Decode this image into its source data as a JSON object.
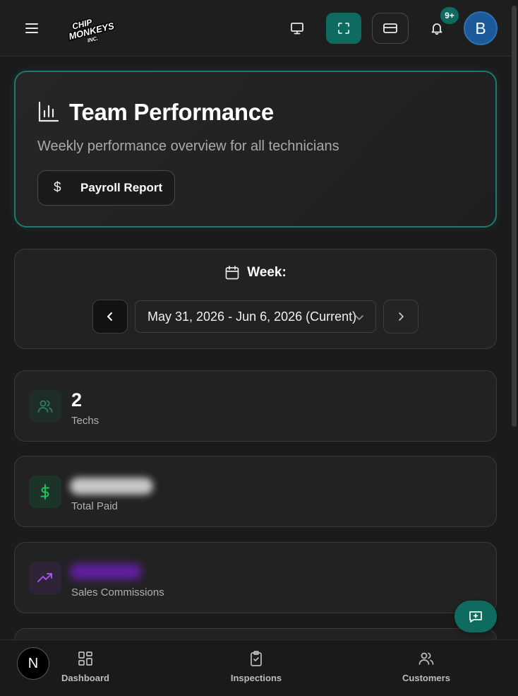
{
  "header": {
    "logo_text": "CHIP MONKEYS INC.",
    "notification_badge": "9+",
    "avatar_letter": "B"
  },
  "hero": {
    "title": "Team Performance",
    "subtitle": "Weekly performance overview for all technicians",
    "payroll_button_icon": "$",
    "payroll_button_label": "Payroll Report"
  },
  "week": {
    "label": "Week:",
    "selected": "May 31, 2026 - Jun 6, 2026 (Current)"
  },
  "stats": {
    "techs": {
      "value": "2",
      "label": "Techs",
      "icon": "users-icon",
      "color": "#2f7d5f"
    },
    "total_paid": {
      "label": "Total Paid",
      "icon": "dollar-icon",
      "color": "#22c55e"
    },
    "sales_commissions": {
      "label": "Sales Commissions",
      "icon": "trending-up-icon",
      "color": "#a855f7"
    }
  },
  "bottom_nav": {
    "next_badge": "N",
    "items": [
      {
        "label": "Dashboard",
        "icon": "dashboard-icon"
      },
      {
        "label": "Inspections",
        "icon": "clipboard-check-icon"
      },
      {
        "label": "Customers",
        "icon": "users-icon"
      }
    ]
  },
  "colors": {
    "accent": "#0f6b60",
    "background": "#1b1b1b",
    "card": "#222222"
  }
}
